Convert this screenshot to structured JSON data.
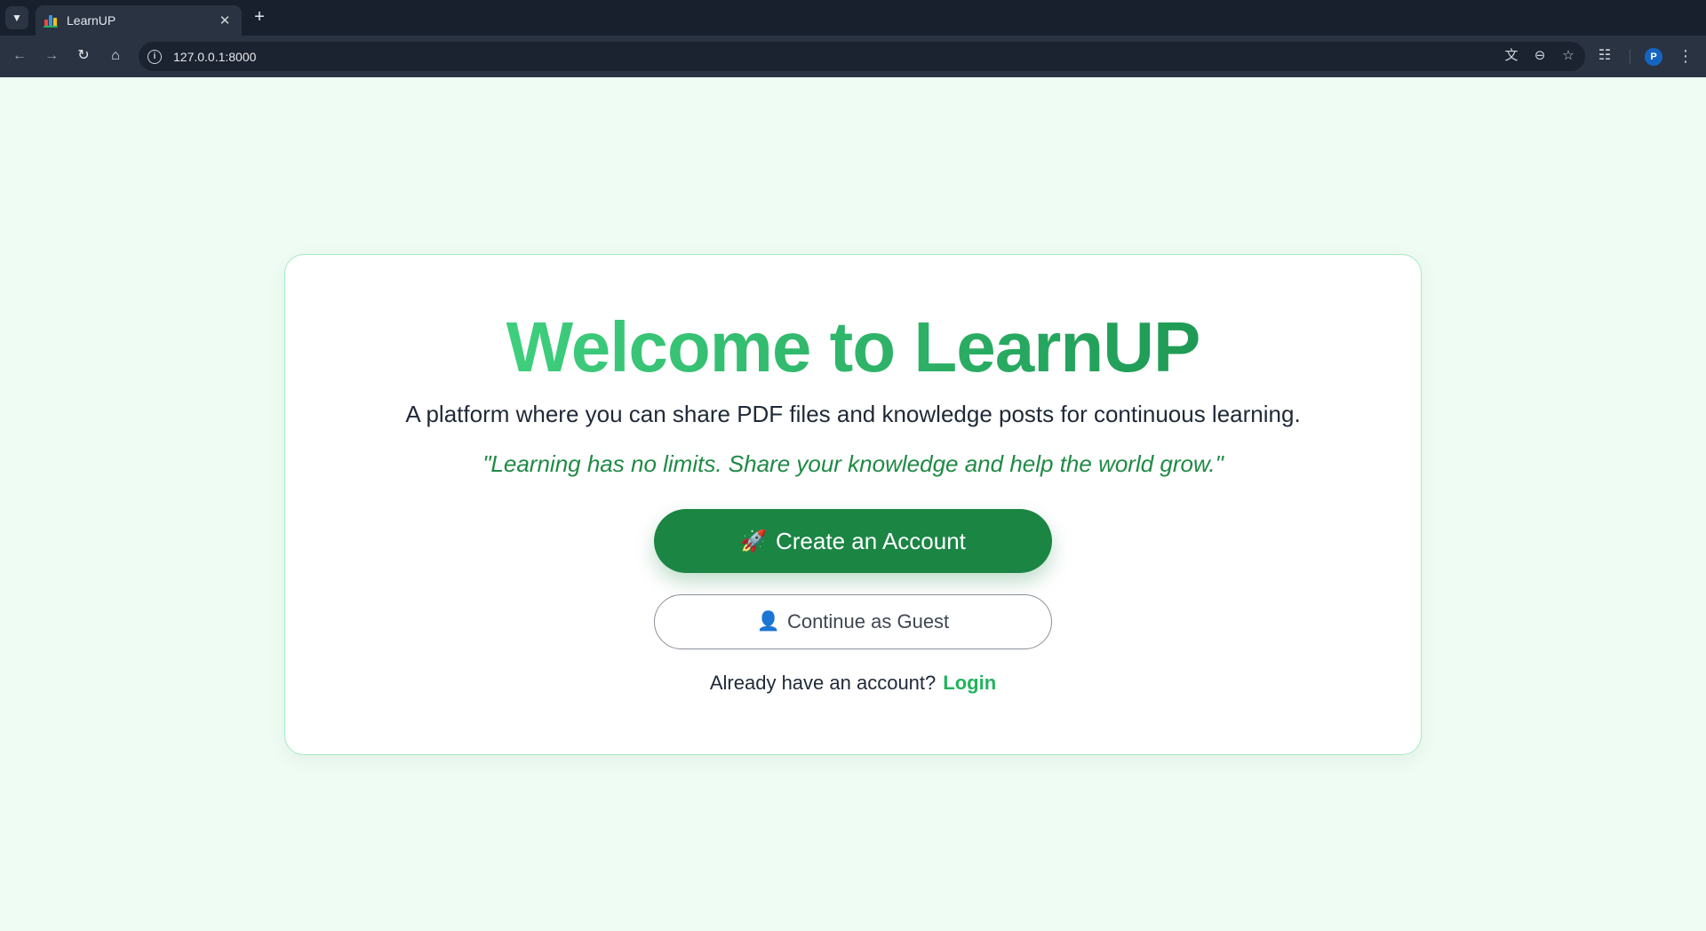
{
  "browser": {
    "tab_title": "LearnUP",
    "url": "127.0.0.1:8000",
    "profile_initial": "P",
    "icons": {
      "tab_search": "chevron-down-icon",
      "back": "arrow-left-icon",
      "forward": "arrow-right-icon",
      "reload": "reload-icon",
      "home": "home-icon",
      "translate": "translate-icon",
      "zoom": "zoom-out-icon",
      "bookmark": "star-icon",
      "extensions": "puzzle-icon",
      "menu": "kebab-menu-icon"
    }
  },
  "page": {
    "headline": "Welcome to LearnUP",
    "tagline": "A platform where you can share PDF files and knowledge posts for continuous learning.",
    "quote": "\"Learning has no limits. Share your knowledge and help the world grow.\"",
    "primary_button": {
      "icon": "🚀",
      "label": "Create an Account"
    },
    "secondary_button": {
      "icon": "👤",
      "label": "Continue as Guest"
    },
    "login_prompt": "Already have an account?",
    "login_link": "Login"
  },
  "colors": {
    "page_bg": "#eefcf3",
    "primary_green": "#1b8544",
    "accent_green": "#22b35e",
    "quote_green": "#1e8a45",
    "card_border": "#a7ebc2"
  }
}
